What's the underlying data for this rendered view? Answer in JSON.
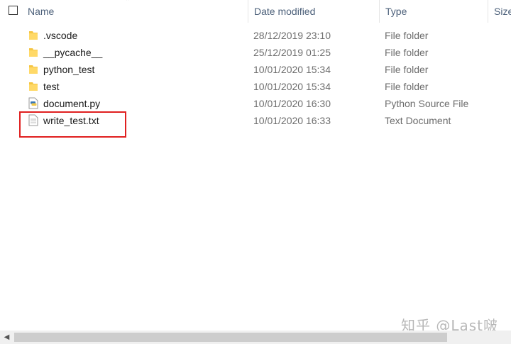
{
  "header": {
    "name": "Name",
    "date_modified": "Date modified",
    "type": "Type",
    "size": "Size"
  },
  "files": [
    {
      "name": ".vscode",
      "date": "28/12/2019 23:10",
      "type": "File folder",
      "icon": "folder-icon"
    },
    {
      "name": "__pycache__",
      "date": "25/12/2019 01:25",
      "type": "File folder",
      "icon": "folder-icon"
    },
    {
      "name": "python_test",
      "date": "10/01/2020 15:34",
      "type": "File folder",
      "icon": "folder-icon"
    },
    {
      "name": "test",
      "date": "10/01/2020 15:34",
      "type": "File folder",
      "icon": "folder-icon"
    },
    {
      "name": "document.py",
      "date": "10/01/2020 16:30",
      "type": "Python Source File",
      "icon": "python-file-icon"
    },
    {
      "name": "write_test.txt",
      "date": "10/01/2020 16:33",
      "type": "Text Document",
      "icon": "text-file-icon"
    }
  ],
  "highlight_color": "#e02020",
  "watermark": "知乎 @Last啵"
}
